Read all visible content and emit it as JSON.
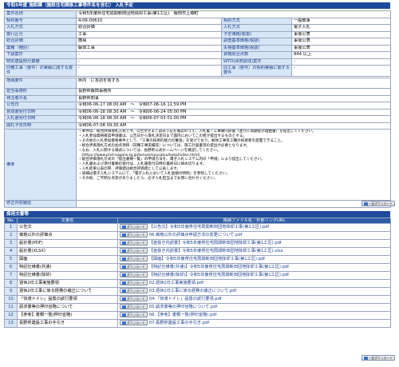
{
  "header": {
    "title": "令和5年度 施設課（施設住宅関係工事等件名を含む） 入札予定"
  },
  "info_rows": [
    {
      "l1": "案件名称",
      "v1": "令和5年度県住宅局関新田団地除却工事(第1工区)　飯田市上郷町",
      "wide": true
    },
    {
      "l1": "契約番号",
      "v1": "4-06-00610",
      "l2": "契約方式",
      "v2": "一般競争"
    },
    {
      "l1": "入札方式",
      "v1": "総合評価",
      "l2": "入札方法",
      "v2": "電子入札"
    },
    {
      "l1": "施行区分",
      "v1": "工事",
      "l2": "予定価格(税抜)",
      "v2": "事後公表"
    },
    {
      "l1": "総合評価",
      "v1": "簡易",
      "l2": "調査基準価格(税抜)",
      "v2": "事後公表"
    },
    {
      "l1": "業種（種別）",
      "v1": "解体工事",
      "l2": "失格基準価格(税抜)",
      "v2": "事後公表"
    },
    {
      "l1": "下請案件",
      "v1": "-",
      "l2": "資格総合点数",
      "v2": "844 以上"
    },
    {
      "l1": "特定建設部分業種",
      "v1": "-",
      "l2": "WTO(政府調達)案件",
      "v2": "-"
    },
    {
      "l1": "同種工事（要件）の実績に関する要件",
      "v1": "-",
      "l2": "同工事（要件）の契約実績に関する要件",
      "v2": "-"
    }
  ],
  "rows2": [
    {
      "label": "地域要件",
      "value": "県内　に本店を有する"
    },
    {
      "label": "担当事務所",
      "value": "長野県飯田事務所"
    },
    {
      "label": "発注者の長",
      "value": "長野県知事"
    },
    {
      "label": "公告日",
      "value": "令和06-06-17 08:00 AM　〜　令和07-06-16 11:59 PM"
    },
    {
      "label": "質問書受付日時",
      "value": "令和06-06-18 08:30 AM　〜　令和06-06-24 05:00 PM"
    },
    {
      "label": "入札書受付日時",
      "value": "令和06-06-18 08:30 AM　〜　令和06-07-03 01:00 PM"
    },
    {
      "label": "開札予定日時",
      "value": "令和06-07-08 09:30 AM"
    }
  ],
  "remarks": {
    "label": "備考",
    "lines": [
      "・本件は、総合評価落札方式です。公告文をよく読み下記を確認のうえ、入札書・工事費内訳書（並びに高額提示理由書）を提出してください。",
      "・入札参加資格確認申請書は、公告日から落札決定日まで国内においてこの者が提出するものとする。",
      "・その他の入札参加資格要件として、「工事の技術的能力の審査」を受けており、解体工事等工種の技術者を配置できること。",
      "・総合評価落札方式の加点項目（同種工事実績等）については、施工計画書等の提出が必要となります。",
      "・なお、入札に関する様式については、長野県公式ホームページを確認してください。",
      "　(https://www.pref.nagano.lg.jp/kensei/nyusatsu/koko/index.html)",
      "・総合評価落札方式の「提出書類一覧」の申請方法を、電子入札システム内の「申請」により提出してください。",
      "・入札書および添付書類の受付は、入札書受付日時の最終日に締め切ります。",
      "・入札結果公表の際、評価値は総合評価値として公表します。",
      "・詳細は電子入札システムにて、「電子入札において入札金額の特例」を参照してください。",
      "・その他、ご不明な点等がありましたら、必ず入札担当までお問い合わせください。"
    ]
  },
  "last_row": {
    "label": "修正内容履歴",
    "value": ""
  },
  "download_all_label": "一括ダウンロード",
  "docs_section": {
    "title": "採用文書等",
    "columns": [
      "No.",
      "文書名",
      "格納ファイル名／外部リンクURL"
    ],
    "download_label": "ダウンロード",
    "docs": [
      {
        "no": "1",
        "name": "公告文",
        "file": "【公告文】令和5年度県住宅局関新田団地除却工事(第1工区).pdf"
      },
      {
        "no": "2",
        "name": "価格以外の評価点",
        "file": "06.価格以外の評価点申請方法の変更について.pdf"
      },
      {
        "no": "3",
        "name": "設計書(PDF)",
        "file": "【金抜き内訳書】令和5年度県住宅局関新田団地除却工事(第1工区).pdf"
      },
      {
        "no": "4",
        "name": "設計書(XLSX)",
        "file": "【金抜き内訳書】令和5年度県住宅局関新田団地除却工事(第1工区).xlsx"
      },
      {
        "no": "5",
        "name": "図面",
        "file": "【図面】令和5年度県住宅局関新田団地除却工事(第1工区).pdf"
      },
      {
        "no": "6",
        "name": "特記仕様書(共通)",
        "file": "【特記仕様書(共通)】令和5年度県住宅局関新田団地除却工事(第1工区).pdf"
      },
      {
        "no": "7",
        "name": "特記仕様書(除却)",
        "file": "【特記仕様書(除却)】令和5年度県住宅局関新田団地除却工事(第1工区).pdf"
      },
      {
        "no": "8",
        "name": "週休2日工事実施要領",
        "file": "02.週休2日工事実施要領.pdf"
      },
      {
        "no": "9",
        "name": "週休2日工事に係る経費の補正について",
        "file": "03.週休2日工事に係る経費の補正について.pdf"
      },
      {
        "no": "10",
        "name": "「快適トイレ」設置の試行要領",
        "file": "04.「快適トイレ」設置の試行要領.pdf"
      },
      {
        "no": "11",
        "name": "請求書等の押印省略について",
        "file": "05.請求書等の押印省略について.pdf"
      },
      {
        "no": "12",
        "name": "【参考】書類一覧(押印省略)",
        "file": "06.【参考】書類一覧(押印省略).pdf"
      },
      {
        "no": "13",
        "name": "長野県建設工事の手引き",
        "file": "07.長野県建設工事の手引き.pdf"
      }
    ]
  }
}
